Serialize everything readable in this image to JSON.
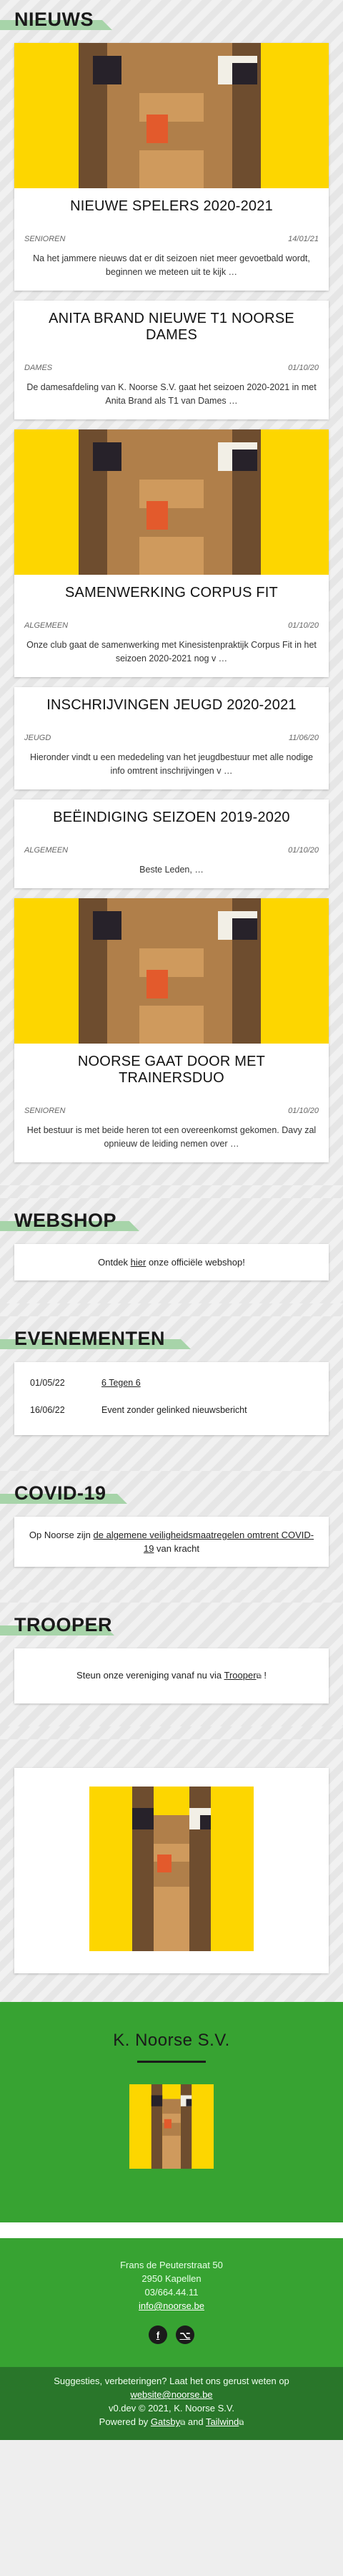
{
  "colors": {
    "green": "#37a332",
    "dark_green": "#29762a",
    "yellow": "#fdd600",
    "title_band": "#a7d4a9"
  },
  "nieuws": {
    "title": "NIEUWS",
    "articles": [
      {
        "has_image": true,
        "title": "NIEUWE SPELERS 2020-2021",
        "category": "SENIOREN",
        "date": "14/01/21",
        "excerpt": "Na het jammere nieuws dat er dit seizoen niet meer gevoetbald wordt, beginnen we meteen uit te kijk …"
      },
      {
        "has_image": false,
        "title": "ANITA BRAND NIEUWE T1 NOORSE DAMES",
        "category": "DAMES",
        "date": "01/10/20",
        "excerpt": "De damesafdeling van K. Noorse S.V. gaat het seizoen 2020-2021 in met Anita Brand als T1 van Dames …"
      },
      {
        "has_image": true,
        "title": "SAMENWERKING CORPUS FIT",
        "category": "ALGEMEEN",
        "date": "01/10/20",
        "excerpt": "Onze club gaat de samenwerking met Kinesistenpraktijk Corpus Fit in het seizoen 2020-2021 nog v …"
      },
      {
        "has_image": false,
        "title": "INSCHRIJVINGEN JEUGD 2020-2021",
        "category": "JEUGD",
        "date": "11/06/20",
        "excerpt": "Hieronder vindt u een mededeling van het jeugdbestuur met alle nodige info omtrent inschrijvingen v …"
      },
      {
        "has_image": false,
        "title": "BEËINDIGING SEIZOEN 2019-2020",
        "category": "ALGEMEEN",
        "date": "01/10/20",
        "excerpt": "Beste Leden,    …"
      },
      {
        "has_image": true,
        "title": "NOORSE GAAT DOOR MET TRAINERSDUO",
        "category": "SENIOREN",
        "date": "01/10/20",
        "excerpt": "Het bestuur is met beide heren tot een overeenkomst gekomen. Davy zal opnieuw de leiding nemen over …"
      }
    ]
  },
  "webshop": {
    "title": "WEBSHOP",
    "text_before": "Ontdek ",
    "link": "hier",
    "text_after": " onze officiële webshop!"
  },
  "evenementen": {
    "title": "EVENEMENTEN",
    "events": [
      {
        "date": "01/05/22",
        "name": "6 Tegen 6",
        "linked": true
      },
      {
        "date": "16/06/22",
        "name": "Event zonder gelinked nieuwsbericht",
        "linked": false
      }
    ]
  },
  "covid": {
    "title": "COVID-19",
    "text_before": "Op Noorse zijn ",
    "link": "de algemene veiligheidsmaatregelen omtrent COVID-19",
    "text_after": " van kracht"
  },
  "trooper": {
    "title": "TROOPER",
    "text_before": "Steun onze vereniging vanaf nu via ",
    "link": "Trooper",
    "text_after": " !"
  },
  "footer": {
    "club_name": "K. Noorse S.V.",
    "address": "Frans de Peuterstraat 50",
    "city": "2950 Kapellen",
    "phone": "03/664.44.11",
    "email": "info@noorse.be",
    "suggestion": "Suggesties, verbeteringen? Laat het ons gerust weten op",
    "website_email": "website@noorse.be",
    "version_line": "v0.dev © 2021, K. Noorse S.V.",
    "powered_prefix": "Powered by ",
    "gatsby": "Gatsby",
    "and": " and ",
    "tailwind": "Tailwind",
    "socials": [
      {
        "icon": "facebook-icon"
      },
      {
        "icon": "github-icon"
      }
    ]
  }
}
